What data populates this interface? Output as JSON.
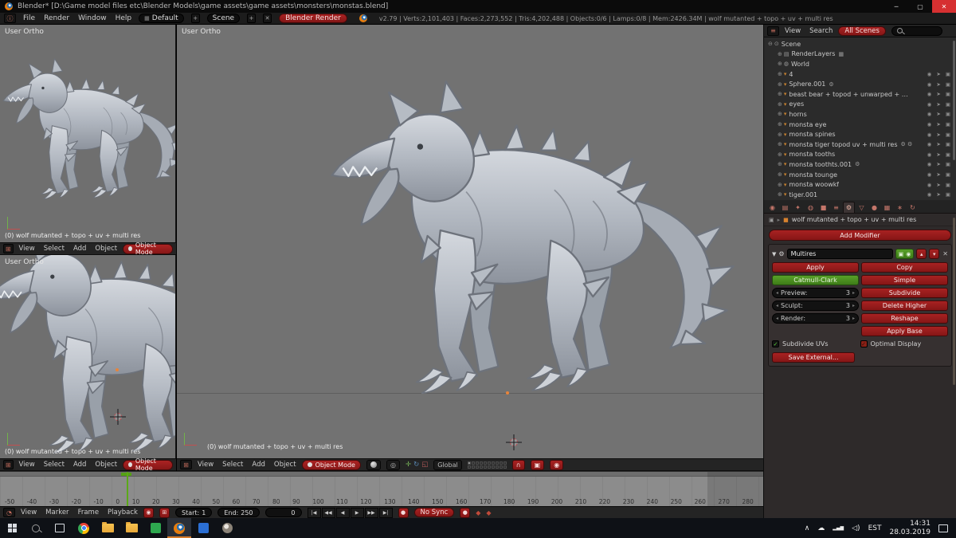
{
  "window": {
    "title": "Blender* [D:\\Game model files etc\\Blender Models\\game assets\\game assets\\monsters\\monstas.blend]",
    "controls": [
      {
        "name": "minimize",
        "glyph": "─"
      },
      {
        "name": "maximize",
        "glyph": "▢"
      },
      {
        "name": "close",
        "glyph": "✕"
      }
    ]
  },
  "topbar": {
    "menus": [
      "File",
      "Render",
      "Window",
      "Help"
    ],
    "layout_value": "Default",
    "scene_value": "Scene",
    "engine_value": "Blender Render",
    "stats": "v2.79 | Verts:2,101,403 | Faces:2,273,552 | Tris:4,202,488 | Objects:0/6 | Lamps:0/8 | Mem:2426.34M | wolf mutanted + topo + uv + multi res"
  },
  "viewport": {
    "ortho_label": "User Ortho",
    "object_info": "(0) wolf mutanted + topo + uv + multi res",
    "menus": [
      "View",
      "Select",
      "Add",
      "Object"
    ],
    "mode": "Object Mode",
    "orientation": "Global"
  },
  "outliner": {
    "menus": [
      "View",
      "Search"
    ],
    "scenes_filter": "All Scenes",
    "tree": [
      {
        "exp": "⊖",
        "icon": "⊙",
        "label": "Scene",
        "type": "scene",
        "tail": "",
        "toggles": ""
      },
      {
        "exp": "⊕",
        "icon": "▤",
        "label": "RenderLayers",
        "type": "sub",
        "tail": "▦",
        "toggles": ""
      },
      {
        "exp": "⊕",
        "icon": "◍",
        "label": "World",
        "type": "sub",
        "tail": "",
        "toggles": ""
      },
      {
        "exp": "⊕",
        "icon": "▾",
        "label": "4",
        "type": "mesh",
        "tail": "",
        "toggles": "◉ ➤ ▣"
      },
      {
        "exp": "⊕",
        "icon": "▾",
        "label": "Sphere.001",
        "type": "mesh",
        "tail": "⚙",
        "toggles": "◉ ➤ ▣"
      },
      {
        "exp": "⊕",
        "icon": "▾",
        "label": "beast  bear + topod + unwarped + multires",
        "type": "mesh",
        "tail": "",
        "toggles": "◉ ➤ ▣"
      },
      {
        "exp": "⊕",
        "icon": "▾",
        "label": "eyes",
        "type": "mesh",
        "tail": "",
        "toggles": "◉ ➤ ▣"
      },
      {
        "exp": "⊕",
        "icon": "▾",
        "label": "horns",
        "type": "mesh",
        "tail": "",
        "toggles": "◉ ➤ ▣"
      },
      {
        "exp": "⊕",
        "icon": "▾",
        "label": "monsta eye",
        "type": "mesh",
        "tail": "",
        "toggles": "◉ ➤ ▣"
      },
      {
        "exp": "⊕",
        "icon": "▾",
        "label": "monsta spines",
        "type": "mesh",
        "tail": "",
        "toggles": "◉ ➤ ▣"
      },
      {
        "exp": "⊕",
        "icon": "▾",
        "label": "monsta tiger topod uv + multi res",
        "type": "mesh",
        "tail": "⚙ ⚙",
        "toggles": "◉ ➤ ▣"
      },
      {
        "exp": "⊕",
        "icon": "▾",
        "label": "monsta tooths",
        "type": "mesh",
        "tail": "",
        "toggles": "◉ ➤ ▣"
      },
      {
        "exp": "⊕",
        "icon": "▾",
        "label": "monsta toothts.001",
        "type": "mesh",
        "tail": "⚙",
        "toggles": "◉ ➤ ▣"
      },
      {
        "exp": "⊕",
        "icon": "▾",
        "label": "monsta tounge",
        "type": "mesh",
        "tail": "",
        "toggles": "◉ ➤ ▣"
      },
      {
        "exp": "⊕",
        "icon": "▾",
        "label": "monsta woowkf",
        "type": "mesh",
        "tail": "",
        "toggles": "◉ ➤ ▣"
      },
      {
        "exp": "⊕",
        "icon": "▾",
        "label": "tiger.001",
        "type": "mesh",
        "tail": "",
        "toggles": "◉ ➤ ▣"
      }
    ]
  },
  "properties": {
    "tabs": [
      {
        "glyph": "◉",
        "name": "render-tab",
        "state": "normal"
      },
      {
        "glyph": "▤",
        "name": "render-layers-tab",
        "state": "normal"
      },
      {
        "glyph": "✦",
        "name": "scene-tab",
        "state": "normal"
      },
      {
        "glyph": "◍",
        "name": "world-tab",
        "state": "normal"
      },
      {
        "glyph": "■",
        "name": "object-tab",
        "state": "normal"
      },
      {
        "glyph": "≡",
        "name": "constraints-tab",
        "state": "normal"
      },
      {
        "glyph": "⚙",
        "name": "modifiers-tab",
        "state": "active"
      },
      {
        "glyph": "▽",
        "name": "data-tab",
        "state": "normal"
      },
      {
        "glyph": "●",
        "name": "material-tab",
        "state": "normal"
      },
      {
        "glyph": "▦",
        "name": "texture-tab",
        "state": "normal"
      },
      {
        "glyph": "∗",
        "name": "particles-tab",
        "state": "normal"
      },
      {
        "glyph": "↻",
        "name": "physics-tab",
        "state": "normal"
      }
    ],
    "breadcrumb": "wolf mutanted + topo + uv + multi res",
    "add_modifier": "Add Modifier",
    "modifier": {
      "name": "Multires",
      "apply": "Apply",
      "copy": "Copy",
      "type_active": "Catmull-Clark",
      "type_other": "Simple",
      "levels": [
        {
          "label": "Preview:",
          "value": "3"
        },
        {
          "label": "Sculpt:",
          "value": "3"
        },
        {
          "label": "Render:",
          "value": "3"
        }
      ],
      "actions": [
        "Subdivide",
        "Delete Higher",
        "Reshape",
        "Apply Base"
      ],
      "checkboxes": [
        {
          "label": "Subdivide UVs",
          "state": "green",
          "mark": "✓"
        },
        {
          "label": "Optimal Display",
          "state": "red",
          "mark": "✓"
        }
      ],
      "save_external": "Save External..."
    }
  },
  "timeline": {
    "menus": [
      "View",
      "Marker",
      "Frame",
      "Playback"
    ],
    "ticks": [
      "-50",
      "-40",
      "-30",
      "-20",
      "-10",
      "0",
      "10",
      "20",
      "30",
      "40",
      "50",
      "60",
      "70",
      "80",
      "90",
      "100",
      "110",
      "120",
      "130",
      "140",
      "150",
      "160",
      "170",
      "180",
      "190",
      "200",
      "210",
      "220",
      "230",
      "240",
      "250",
      "260",
      "270",
      "280"
    ],
    "start_label": "Start:",
    "start_value": "1",
    "end_label": "End:",
    "end_value": "250",
    "current_frame": "0",
    "playback": [
      "|◀",
      "◀◀",
      "◀",
      "▶",
      "▶▶",
      "▶|"
    ],
    "sync": "No Sync"
  },
  "taskbar": {
    "lang": "EST",
    "time": "14:31",
    "date": "28.03.2019"
  },
  "icons": {
    "editor_info": "ⓘ",
    "editor_view3d": "⊞",
    "editor_outliner": "≡",
    "editor_timeline": "◔",
    "layout_grid": "▦",
    "plus": "+",
    "close_small": "✕",
    "dropdown": "▾",
    "pivot": "◎",
    "manip_move": "✛",
    "manip_rotate": "↻",
    "manip_scale": "◱",
    "magnet": "∩",
    "render_small": "▣",
    "opengl_small": "◉",
    "panel_open": "▼",
    "wrench": "⚙",
    "cam_toggle": "▣",
    "eye_toggle": "◉",
    "arrow_up": "▴",
    "arrow_down": "▾",
    "left_arrow": "◂",
    "right_arrow": "▸",
    "record": "●",
    "key": "◆",
    "toggle_a": "◉",
    "toggle_b": "⊞",
    "chevron_up": "∧",
    "cloud": "☁",
    "net_bars": "▂▄▆",
    "volume": "◁)",
    "crumb_data": "▣",
    "crumb_sep": "▸",
    "crumb_obj": "■"
  }
}
